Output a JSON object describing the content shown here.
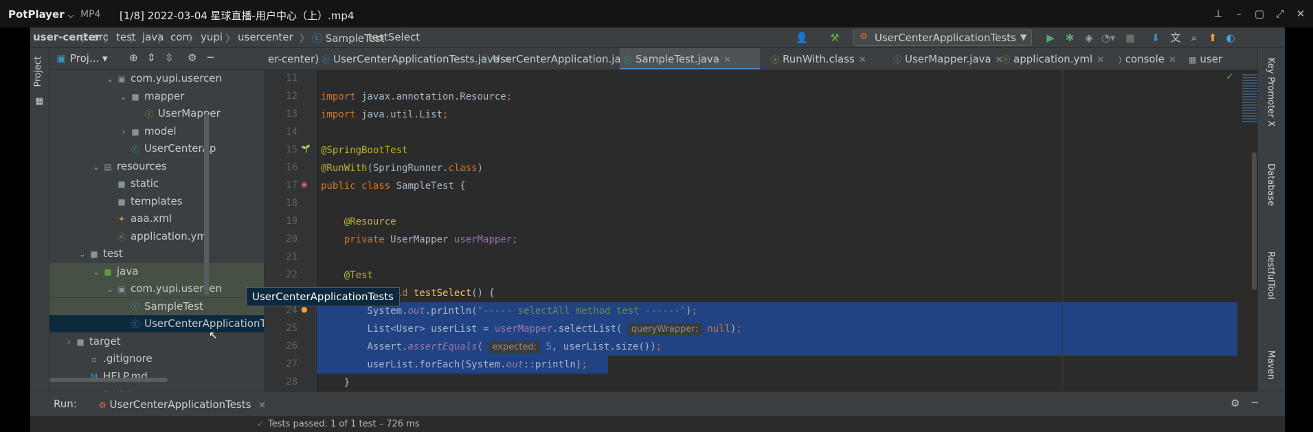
{
  "player": {
    "brand": "PotPlayer",
    "brand_chevron": "⌵",
    "format": "MP4",
    "file_title": "[1/8] 2022-03-04 星球直播-用户中心（上）.mp4",
    "buttons": [
      "pin-icon",
      "minimize-icon",
      "maximize-icon",
      "fullscreen-icon",
      "close-icon"
    ]
  },
  "nav": {
    "crumbs": [
      "user-center",
      "src",
      "test",
      "java",
      "com",
      "yupi",
      "usercenter",
      "SampleTest",
      "testSelect"
    ],
    "run_config": "UserCenterApplicationTests"
  },
  "left_strip": {
    "project_label": "Project"
  },
  "project": {
    "header_label": "Proj...",
    "rows": [
      {
        "indent": 4,
        "arrow": "⌄",
        "icon": "package-icon",
        "label": "com.yupi.usercen"
      },
      {
        "indent": 5,
        "arrow": "⌄",
        "icon": "folder-icon",
        "label": "mapper"
      },
      {
        "indent": 6,
        "arrow": "",
        "icon": "interface-icon",
        "label": "UserMapper"
      },
      {
        "indent": 5,
        "arrow": "›",
        "icon": "folder-icon",
        "label": "model"
      },
      {
        "indent": 5,
        "arrow": "",
        "icon": "class-icon",
        "label": "UserCenterAp"
      },
      {
        "indent": 3,
        "arrow": "⌄",
        "icon": "resources-folder-icon",
        "label": "resources"
      },
      {
        "indent": 4,
        "arrow": "",
        "icon": "folder-icon",
        "label": "static"
      },
      {
        "indent": 4,
        "arrow": "",
        "icon": "folder-icon",
        "label": "templates"
      },
      {
        "indent": 4,
        "arrow": "",
        "icon": "xml-icon",
        "label": "aaa.xml"
      },
      {
        "indent": 4,
        "arrow": "",
        "icon": "yml-icon",
        "label": "application.yml"
      },
      {
        "indent": 2,
        "arrow": "⌄",
        "icon": "folder-icon",
        "label": "test"
      },
      {
        "indent": 3,
        "arrow": "⌄",
        "icon": "java-folder-icon",
        "label": "java"
      },
      {
        "indent": 4,
        "arrow": "⌄",
        "icon": "package-icon",
        "label": "com.yupi.usercen"
      },
      {
        "indent": 5,
        "arrow": "",
        "icon": "class-icon",
        "label": "SampleTest"
      },
      {
        "indent": 5,
        "arrow": "",
        "icon": "class-icon",
        "label": "UserCenterApplicationTests"
      },
      {
        "indent": 1,
        "arrow": "›",
        "icon": "folder-icon",
        "label": "target"
      },
      {
        "indent": 2,
        "arrow": "",
        "icon": "file-icon",
        "label": ".gitignore"
      },
      {
        "indent": 2,
        "arrow": "",
        "icon": "md-icon",
        "label": "HELP.md"
      },
      {
        "indent": 2,
        "arrow": "",
        "icon": "file-icon",
        "label": "mvnw"
      }
    ],
    "tooltip": "UserCenterApplicationTests"
  },
  "tabs": [
    {
      "label": "er-center)",
      "icon": "",
      "active": false,
      "close": false
    },
    {
      "label": "UserCenterApplicationTests.java",
      "icon": "class-icon",
      "active": false,
      "close": true
    },
    {
      "label": "UserCenterApplication.java",
      "icon": "class-icon",
      "active": false,
      "close": true
    },
    {
      "label": "SampleTest.java",
      "icon": "class-icon",
      "active": true,
      "close": true
    },
    {
      "label": "RunWith.class",
      "icon": "annotation-icon",
      "active": false,
      "close": true
    },
    {
      "label": "UserMapper.java",
      "icon": "interface-icon",
      "active": false,
      "close": true
    },
    {
      "label": "application.yml",
      "icon": "yml-icon",
      "active": false,
      "close": true
    },
    {
      "label": "console",
      "icon": "console-icon",
      "active": false,
      "close": true
    },
    {
      "label": "user",
      "icon": "table-icon",
      "active": false,
      "close": false
    }
  ],
  "editor": {
    "line_numbers": [
      "11",
      "12",
      "13",
      "14",
      "15",
      "16",
      "17",
      "18",
      "19",
      "20",
      "21",
      "22",
      "23",
      "24",
      "25",
      "26",
      "27",
      "28"
    ],
    "hints": {
      "expected": "expected:",
      "query_wrapper": "queryWrapper:"
    }
  },
  "right_strip": [
    "Key Promoter X",
    "Database",
    "RestfulTool",
    "Maven"
  ],
  "run": {
    "label": "Run:",
    "config": "UserCenterApplicationTests",
    "status_partial": "Tests passed: 1 of 1 test – 726 ms"
  }
}
